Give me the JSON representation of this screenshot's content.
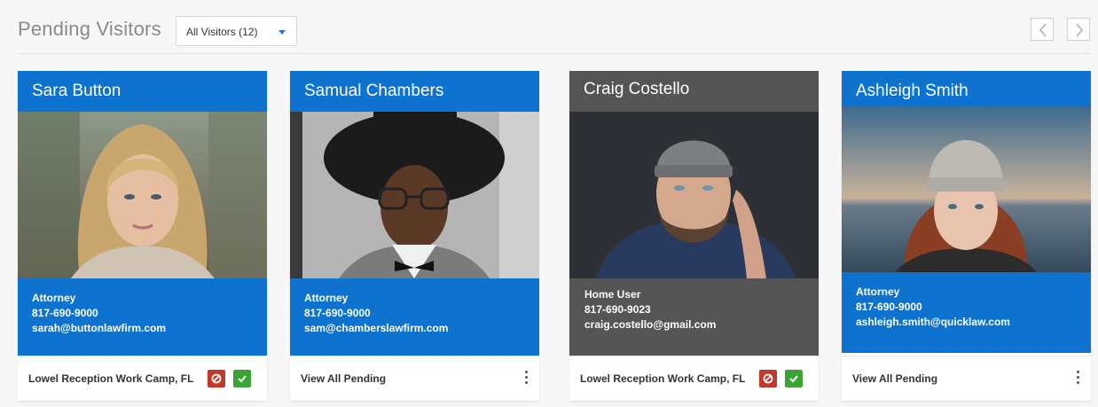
{
  "header": {
    "title": "Pending Visitors",
    "filter_label": "All Visitors (12)"
  },
  "colors": {
    "accent_blue": "#0d73cf",
    "selected_gray": "#555555",
    "deny_red": "#c0392b",
    "approve_green": "#3aa535"
  },
  "cards": [
    {
      "name": "Sara Button",
      "role": "Attorney",
      "phone": "817-690-9000",
      "email": "sarah@buttonlawfirm.com",
      "footer": "Lowel Reception Work Camp, FL",
      "photo_icon": "person-photo"
    },
    {
      "name": "Samual Chambers",
      "role": "Attorney",
      "phone": "817-690-9000",
      "email": "sam@chamberslawfirm.com",
      "footer": "View All Pending",
      "photo_icon": "person-photo"
    },
    {
      "name": "Craig Costello",
      "role": "Home User",
      "phone": "817-690-9023",
      "email": "craig.costello@gmail.com",
      "footer": "Lowel Reception Work Camp, FL",
      "photo_icon": "person-photo"
    },
    {
      "name": "Ashleigh Smith",
      "role": "Attorney",
      "phone": "817-690-9000",
      "email": "ashleigh.smith@quicklaw.com",
      "footer": "View All Pending",
      "photo_icon": "person-photo"
    }
  ]
}
